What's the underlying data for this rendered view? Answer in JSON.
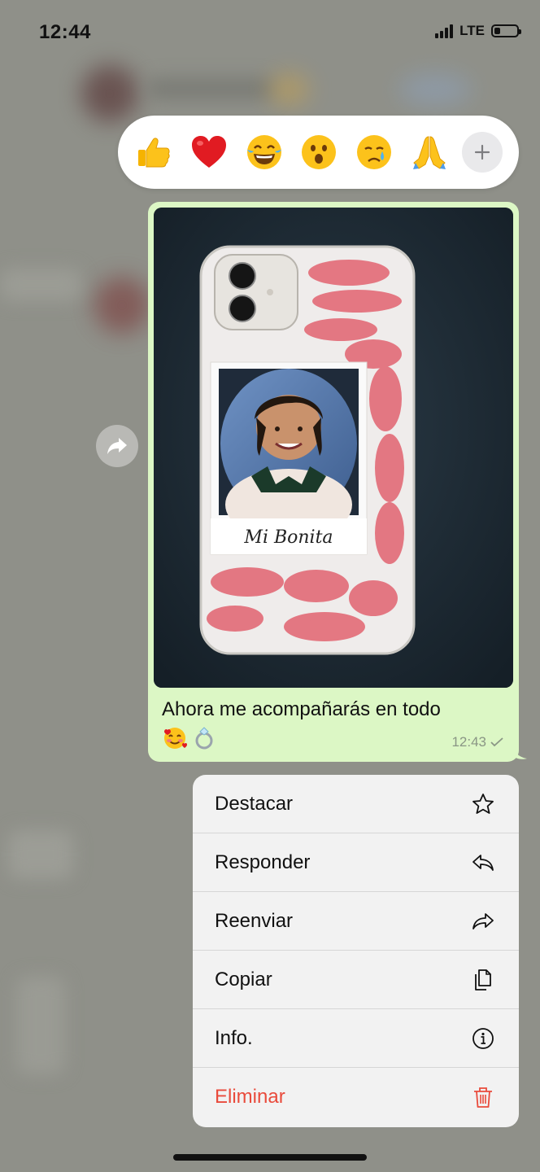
{
  "status_bar": {
    "time": "12:44",
    "network": "LTE",
    "battery_level": 0.25
  },
  "reactions": {
    "items": [
      {
        "name": "thumbs-up-emoji"
      },
      {
        "name": "red-heart-emoji"
      },
      {
        "name": "tears-of-joy-emoji"
      },
      {
        "name": "surprised-face-emoji"
      },
      {
        "name": "crying-face-emoji"
      },
      {
        "name": "folded-hands-emoji"
      }
    ],
    "more_icon": "plus-icon"
  },
  "message": {
    "photo_caption": "Mi Bonita",
    "text": "Ahora me acompañarás en todo",
    "emojis": [
      "🥰",
      "💍"
    ],
    "time": "12:43",
    "status_icon": "check-icon"
  },
  "context_menu": {
    "items": [
      {
        "label": "Destacar",
        "icon": "star-icon"
      },
      {
        "label": "Responder",
        "icon": "reply-icon"
      },
      {
        "label": "Reenviar",
        "icon": "forward-icon"
      },
      {
        "label": "Copiar",
        "icon": "copy-icon"
      },
      {
        "label": "Info.",
        "icon": "info-icon"
      },
      {
        "label": "Eliminar",
        "icon": "trash-icon",
        "destructive": true
      }
    ]
  },
  "colors": {
    "bubble": "#dcf7c5",
    "destructive": "#e94b3c",
    "overlay": "#8f9089"
  }
}
